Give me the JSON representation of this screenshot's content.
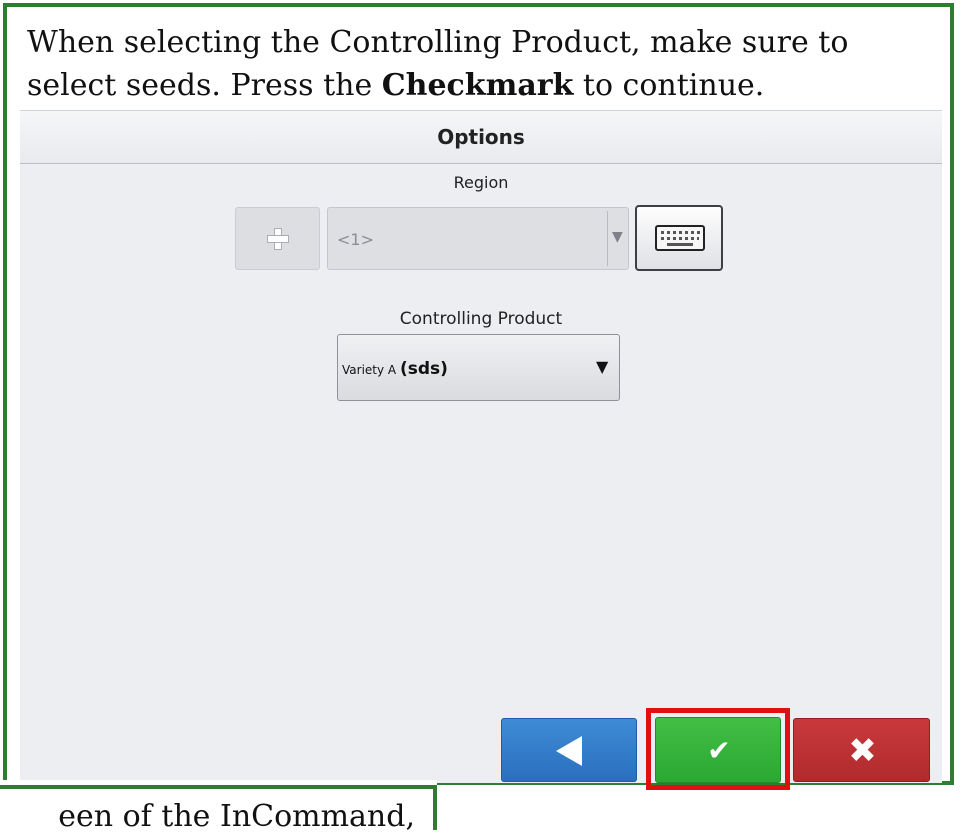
{
  "instruction": {
    "part1": "When selecting the Controlling Product, make sure to select seeds. Press the ",
    "bold": "Checkmark",
    "part2": " to continue."
  },
  "screen": {
    "title": "Options",
    "region": {
      "label": "Region",
      "value": "<1>",
      "add_icon": "plus-icon",
      "keyboard_icon": "keyboard-icon"
    },
    "controlling_product": {
      "label": "Controlling Product",
      "value_small": "Variety A ",
      "value_big": "(sds)"
    },
    "nav": {
      "back_icon": "back-arrow-icon",
      "ok_symbol": "✔",
      "cancel_symbol": "✖",
      "highlight_color": "#e01010",
      "ok_color": "#2eaa35",
      "back_color": "#2f78c6",
      "cancel_color": "#b92f32"
    }
  },
  "caption_bottom": {
    "text": "een of the InCommand,"
  },
  "frame_color": "#2e7d32"
}
